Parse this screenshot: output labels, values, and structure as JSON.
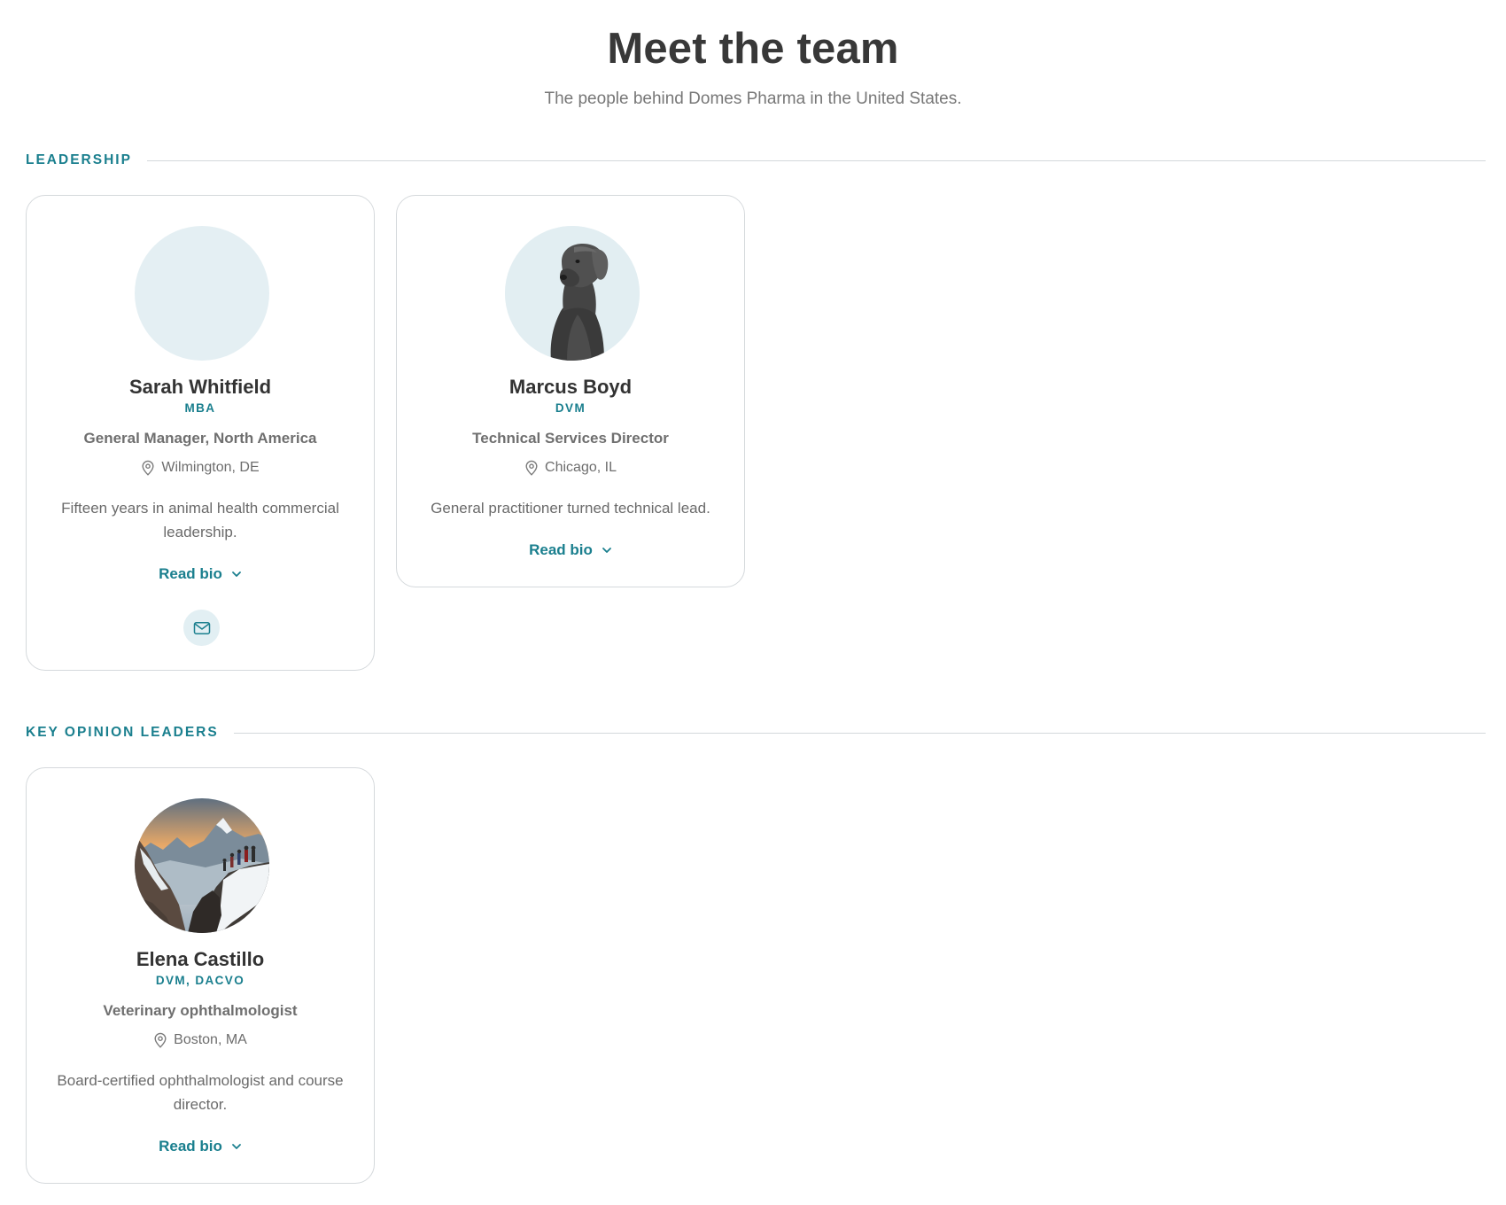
{
  "header": {
    "title": "Meet the team",
    "subtitle": "The people behind Domes Pharma in the United States."
  },
  "sections": [
    {
      "label": "LEADERSHIP",
      "members": [
        {
          "name": "Sarah Whitfield",
          "credentials": "MBA",
          "role": "General Manager, North America",
          "location": "Wilmington, DE",
          "summary": "Fifteen years in animal health commercial leadership.",
          "read_bio": "Read bio",
          "avatar": "placeholder",
          "has_email": true
        },
        {
          "name": "Marcus Boyd",
          "credentials": "DVM",
          "role": "Technical Services Director",
          "location": "Chicago, IL",
          "summary": "General practitioner turned technical lead.",
          "read_bio": "Read bio",
          "avatar": "dog-photo",
          "has_email": false
        }
      ]
    },
    {
      "label": "KEY OPINION LEADERS",
      "members": [
        {
          "name": "Elena Castillo",
          "credentials": "DVM, DACVO",
          "role": "Veterinary ophthalmologist",
          "location": "Boston, MA",
          "summary": "Board-certified ophthalmologist and course director.",
          "read_bio": "Read bio",
          "avatar": "mountain-photo",
          "has_email": false
        }
      ]
    }
  ],
  "icons": {
    "location": "map-pin-icon",
    "expand": "chevron-down-icon",
    "email": "mail-icon"
  },
  "colors": {
    "accent": "#1a7f8e",
    "avatar_bg": "#e4eff3",
    "border": "#d5d9dc"
  }
}
